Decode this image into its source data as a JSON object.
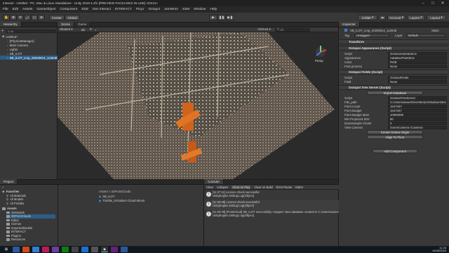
{
  "window": {
    "title": "Interact - Untitled - PC, Mac & Linux Standalone - Unity 2019.4.4f1 [PREVIEW PACKAGES IN USE] <DX11>"
  },
  "menu": [
    "File",
    "Edit",
    "Assets",
    "GameObject",
    "Component",
    "SDE",
    "Dev Interact",
    "INTERACT",
    "Pixyz",
    "Octopoi",
    "JsmWorx",
    "XSM",
    "Window",
    "Help"
  ],
  "toolbar": {
    "center": "Center",
    "global": "Global",
    "collab": "Collab",
    "account": "Account",
    "layers": "Layers",
    "layout": "Layout"
  },
  "hierarchy": {
    "tab": "Hierarchy",
    "create": "+",
    "search": "All",
    "items": [
      {
        "label": "Untitled*"
      },
      {
        "label": "[PhysicsManager]"
      },
      {
        "label": "Main Camera"
      },
      {
        "label": "Lights"
      },
      {
        "label": "SB_ILOT"
      },
      {
        "label": "SB_ILOT_crop_20200814_112848"
      }
    ]
  },
  "scene": {
    "tabs": [
      "Scene",
      "Game"
    ],
    "shading": "Shaded",
    "mode": "2D",
    "gizmos": "Gizmos",
    "search": "All",
    "persp": "Persp"
  },
  "inspector": {
    "tab": "Inspector",
    "object_name": "SB_ILOT_crop_20200814_112848",
    "static_label": "Static",
    "tag_label": "Tag",
    "tag_value": "Untagged",
    "layer_label": "Layer",
    "layer_value": "Default",
    "components": {
      "transform": "Transform",
      "appearance": {
        "title": "Octopoi Appearance (Script)",
        "rows": [
          {
            "label": "Script",
            "value": "OctopoiAppearance"
          },
          {
            "label": "Appearance",
            "value": "AdaptivePointSize"
          },
          {
            "label": "Color",
            "value": "RGB"
          },
          {
            "label": "Post process",
            "value": "None"
          }
        ]
      },
      "fields": {
        "title": "Octopoi Fields (Script)",
        "rows": [
          {
            "label": "Script",
            "value": "OctopoiFields"
          },
          {
            "label": "Field",
            "value": "None"
          }
        ]
      },
      "tree": {
        "title": "Octopoi Tree Server (Script)",
        "import_button": "Import Database",
        "rows": [
          {
            "label": "Script",
            "value": "OctopoiTreeServer"
          },
          {
            "label": "File_path",
            "value": "C:/Users/xavier/Dev/Interact/Shiatsu/Interact"
          },
          {
            "label": "Point Count",
            "value": "1547257"
          },
          {
            "label": "Point Budget",
            "value": "1547257"
          },
          {
            "label": "Point Budget Main",
            "value": "10000000"
          },
          {
            "label": "Min Projected Size",
            "value": "80"
          },
          {
            "label": "Downsample Chunk",
            "value": "5"
          },
          {
            "label": "View Camera",
            "value": "SceneCamera (Camera)"
          }
        ],
        "center_button": "Center Octree Origin",
        "align_button": "Align To Floor"
      }
    },
    "add_component": "Add Component"
  },
  "project": {
    "tabs": [
      "Project",
      "Console"
    ],
    "create": "+",
    "favorites_label": "Favorites",
    "favorites": [
      "All Materials",
      "All Models",
      "All Prefabs"
    ],
    "assets_label": "Assets",
    "folders": [
      "3DModels",
      "3DPointClouds",
      "Editor",
      "Gizmos",
      "ImportedModels",
      "INTERACT",
      "Plugins",
      "Resources"
    ],
    "breadcrumb": "Assets > 3DPointClouds",
    "files": [
      "SB_ILOT",
      "Trimble_SXSubscr-Cloud-50mm"
    ]
  },
  "console": {
    "tab": "Console",
    "buttons": [
      "Clear",
      "Collapse",
      "Clear on Play",
      "Clear on Build",
      "Error Pause",
      "Editor"
    ],
    "messages": [
      {
        "text": "[11:27:11] Licence check successful",
        "sub": "UnityEngine.Debug:Log(Object)"
      },
      {
        "text": "[11:28:48] Licence check successful",
        "sub": "UnityEngine.Debug:Log(Object)"
      },
      {
        "text": "[11:28:49] [PointCloud] SB_ILOT successfully cropped. New database created in C:/Users/xavier/Dev/Interact/Shiatsu/Interact/Assets/3DPointClouds/SB_ILOT_crop",
        "sub": "UnityEngine.Debug:Log(Object)"
      }
    ]
  },
  "taskbar": {
    "time": "11:28",
    "date": "14/08/2020"
  }
}
